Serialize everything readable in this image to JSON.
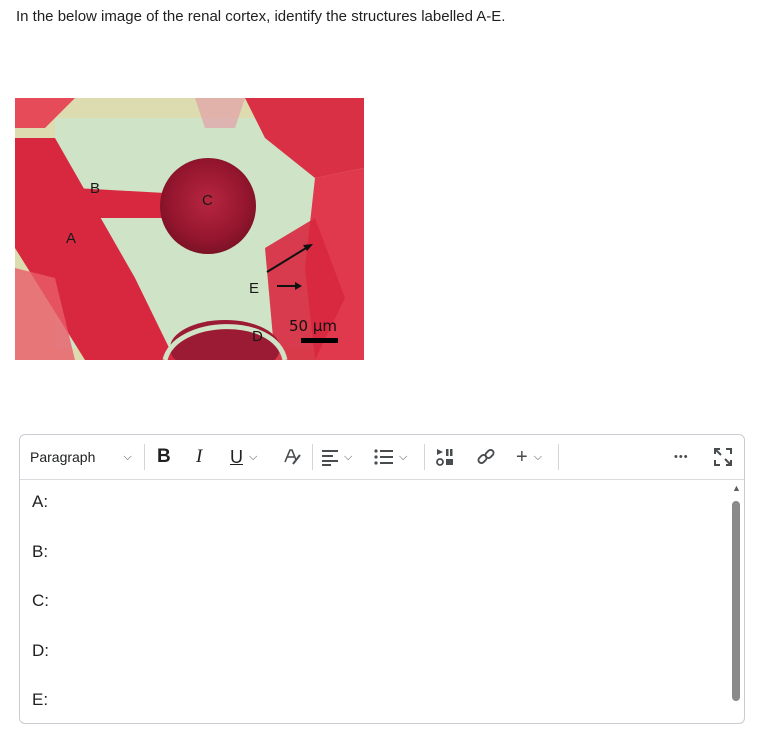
{
  "question": {
    "text": "In the below image of the renal cortex, identify the structures labelled A-E."
  },
  "micrograph": {
    "labels": {
      "a": "A",
      "b": "B",
      "c": "C",
      "d": "D",
      "e": "E"
    },
    "scale_text": "50 µm"
  },
  "toolbar": {
    "paragraph_label": "Paragraph",
    "bold_label": "B",
    "italic_label": "I",
    "underline_label": "U",
    "add_label": "+",
    "more_label": "•••"
  },
  "content": {
    "lines": [
      "A:",
      "B:",
      "C:",
      "D:",
      "E:"
    ]
  },
  "colors": {
    "tissue_red": "#d8283f",
    "glomerulus": "#9c1b34",
    "background_green": "#cfe3c6",
    "border": "#c9cdd2"
  }
}
